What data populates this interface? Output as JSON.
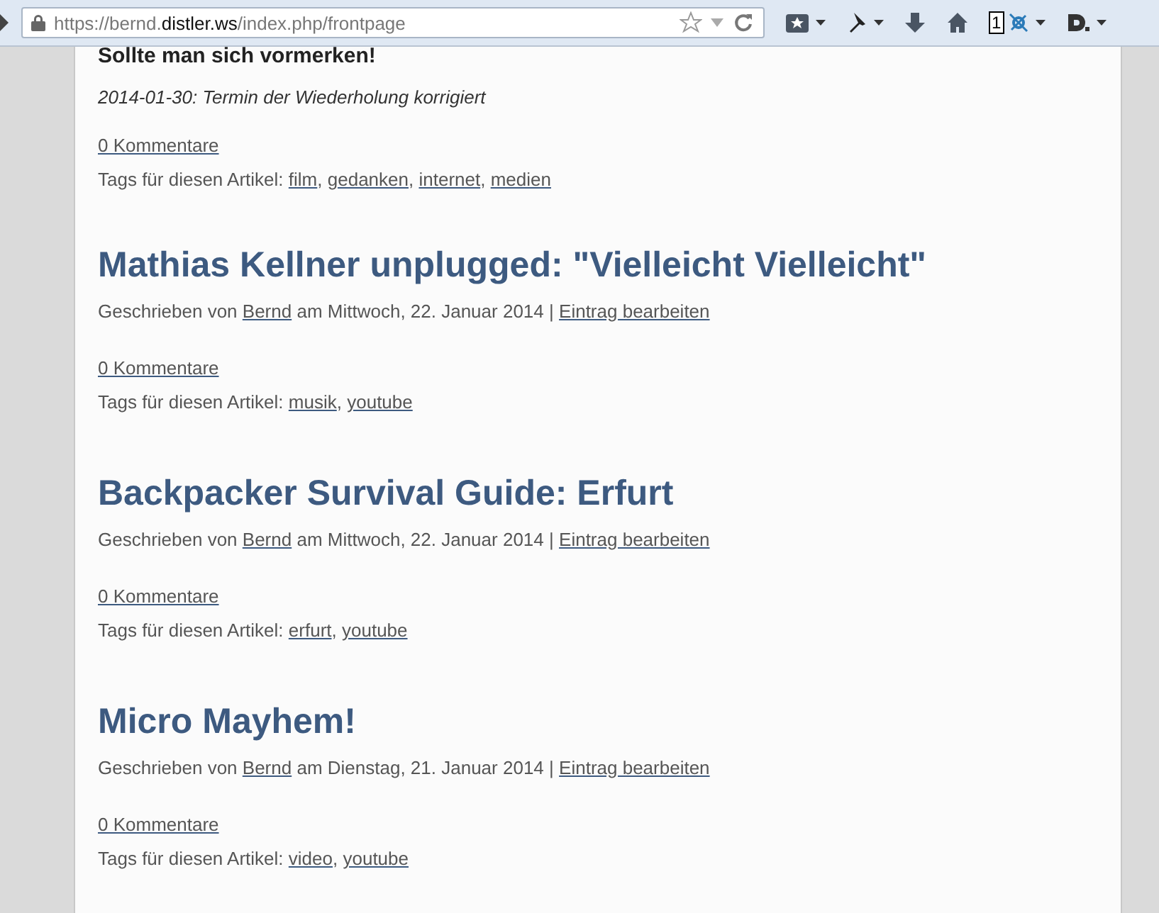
{
  "toolbar": {
    "url": {
      "scheme_host": "https://bernd.",
      "domain": "distler.ws",
      "path": "/index.php/frontpage"
    },
    "badge": "1"
  },
  "first_post": {
    "heading": "Sollte man sich vormerken!",
    "note": "2014-01-30: Termin der Wiederholung korrigiert",
    "comments": "0 Kommentare",
    "tags_label": "Tags für diesen Artikel:",
    "tags": [
      "film",
      "gedanken",
      "internet",
      "medien"
    ]
  },
  "tag_separator": ",",
  "posts": [
    {
      "title": "Mathias Kellner unplugged: \"Vielleicht Vielleicht\"",
      "by_label": "Geschrieben von",
      "author": "Bernd",
      "date": "am Mittwoch, 22. Januar 2014",
      "separator": "|",
      "edit_link": "Eintrag bearbeiten",
      "comments": "0 Kommentare",
      "tags_label": "Tags für diesen Artikel:",
      "tags": [
        "musik",
        "youtube"
      ]
    },
    {
      "title": "Backpacker Survival Guide: Erfurt",
      "by_label": "Geschrieben von",
      "author": "Bernd",
      "date": "am Mittwoch, 22. Januar 2014",
      "separator": "|",
      "edit_link": "Eintrag bearbeiten",
      "comments": "0 Kommentare",
      "tags_label": "Tags für diesen Artikel:",
      "tags": [
        "erfurt",
        "youtube"
      ]
    },
    {
      "title": "Micro Mayhem!",
      "by_label": "Geschrieben von",
      "author": "Bernd",
      "date": "am Dienstag, 21. Januar 2014",
      "separator": "|",
      "edit_link": "Eintrag bearbeiten",
      "comments": "0 Kommentare",
      "tags_label": "Tags für diesen Artikel:",
      "tags": [
        "video",
        "youtube"
      ]
    }
  ]
}
